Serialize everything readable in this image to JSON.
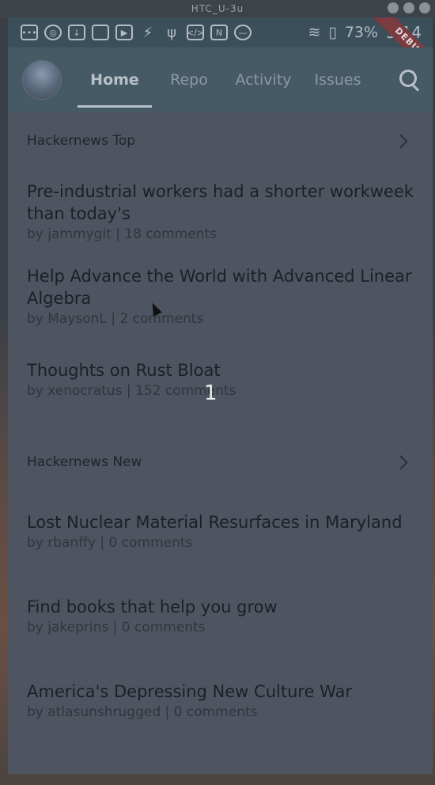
{
  "window": {
    "title": "HTC_U-3u"
  },
  "status_bar": {
    "battery": "73%",
    "time": "5:14",
    "debug_label": "DEBUG"
  },
  "app_bar": {
    "tabs": [
      {
        "label": "Home",
        "active": true
      },
      {
        "label": "Repo",
        "active": false
      },
      {
        "label": "Activity",
        "active": false
      },
      {
        "label": "Issues",
        "active": false
      }
    ],
    "search_icon": "search-icon"
  },
  "sections": [
    {
      "title": "Hackernews Top",
      "stories": [
        {
          "title": "Pre-industrial workers had a shorter workweek than today's",
          "meta": "by jammygit | 18 comments"
        },
        {
          "title": "Help Advance the World with Advanced Linear Algebra",
          "meta": "by MaysonL | 2 comments"
        },
        {
          "title": "Thoughts on Rust Bloat",
          "meta": "by xenocratus | 152 comments"
        }
      ]
    },
    {
      "title": "Hackernews New",
      "stories": [
        {
          "title": "Lost Nuclear Material Resurfaces in Maryland",
          "meta": "by rbanffy | 0 comments"
        },
        {
          "title": "Find books that help you grow",
          "meta": "by jakeprins | 0 comments"
        },
        {
          "title": "America's Depressing New Culture War",
          "meta": "by atlasunshrugged | 0 comments"
        }
      ]
    }
  ],
  "overlay_number": "1"
}
